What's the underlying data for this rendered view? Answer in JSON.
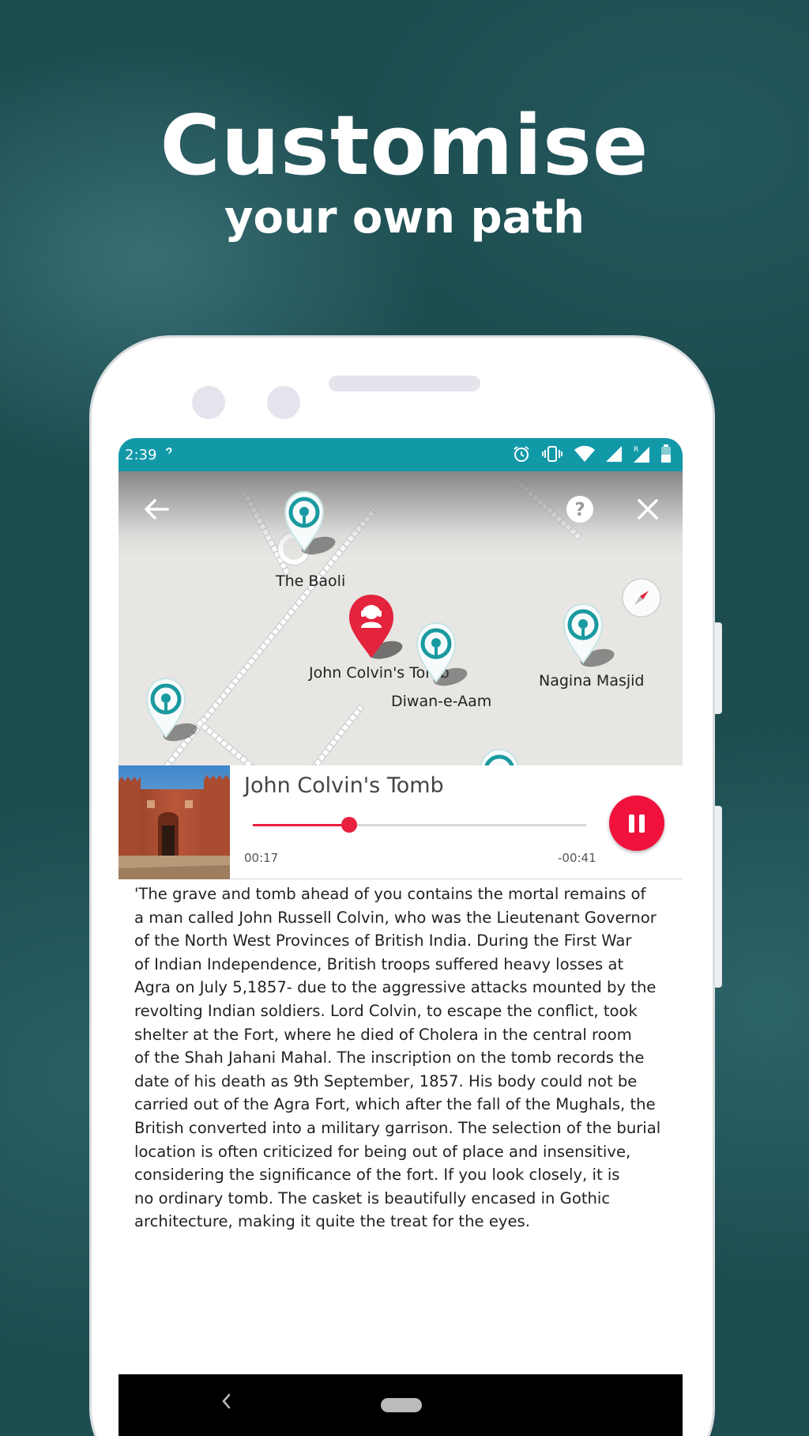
{
  "headline": {
    "title": "Customise",
    "subtitle": "your own path"
  },
  "status_bar": {
    "time": "2:39",
    "icons": [
      "notification-icon",
      "alarm-icon",
      "vibrate-icon",
      "wifi-icon",
      "signal-icon",
      "roaming-signal-icon",
      "battery-icon"
    ],
    "accent_color": "#1199a8"
  },
  "map": {
    "top_icons": [
      "back-arrow-icon",
      "help-icon",
      "close-icon",
      "compass-icon"
    ],
    "pins": [
      {
        "label": "The Baoli",
        "type": "poi"
      },
      {
        "label": "John Colvin's Tomb",
        "type": "current"
      },
      {
        "label": "Diwan-e-Aam",
        "type": "poi"
      },
      {
        "label": "Nagina Masjid",
        "type": "poi"
      },
      {
        "label": "",
        "type": "poi"
      },
      {
        "label": "",
        "type": "poi"
      }
    ],
    "poi_color": "#1a9aa0",
    "current_color": "#e4233d"
  },
  "player": {
    "title": "John Colvin's Tomb",
    "elapsed": "00:17",
    "remaining": "-00:41",
    "progress_fraction": 0.29,
    "accent_color": "#f0113c"
  },
  "description": {
    "lines": [
      "'The grave and tomb ahead of you contains the mortal remains of",
      "a man called John Russell Colvin, who was the Lieutenant Governor",
      "of the North West Provinces of British India. During the First War",
      "of Indian Independence, British troops suffered heavy losses at",
      "Agra on July 5,1857- due to the aggressive attacks mounted by the",
      "revolting Indian soldiers. Lord Colvin, to escape the conflict, took",
      "shelter at the Fort, where he died of Cholera in the central room",
      "of the Shah Jahani Mahal. The inscription on the tomb records the",
      "date of his death as 9th September, 1857. His body could not be",
      "carried out of the Agra Fort, which after the fall of the Mughals, the",
      "British converted into a military garrison. The selection of the burial",
      "location is often criticized for being out of place and insensitive,",
      "considering the significance of the fort. If you look closely, it is",
      "no ordinary tomb. The casket is beautifully encased in Gothic",
      "architecture, making it quite the treat for the eyes."
    ]
  },
  "nav_bar": {
    "icons": [
      "nav-back-icon",
      "nav-home-icon"
    ]
  }
}
